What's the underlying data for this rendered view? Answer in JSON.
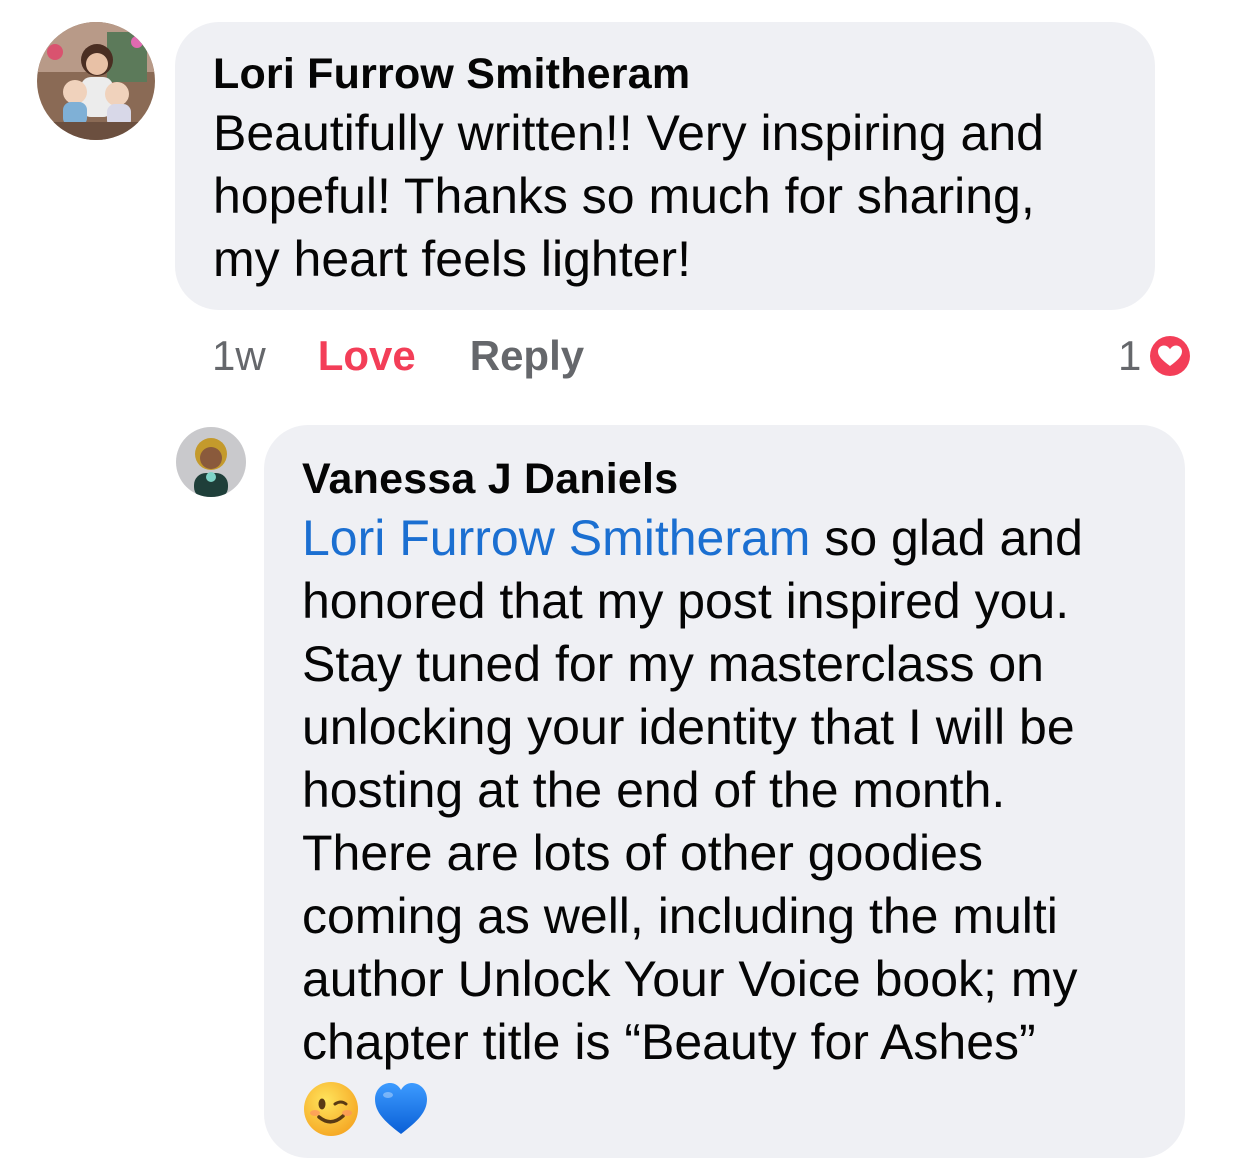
{
  "comment": {
    "author": "Lori Furrow Smitheram",
    "text_lines": [
      "Beautifully written!! Very inspiring and",
      "hopeful! Thanks so much for sharing,",
      "my heart feels lighter!"
    ],
    "time": "1w",
    "love_label": "Love",
    "reply_label": "Reply",
    "reaction_count": "1",
    "reaction_icon": "love-reaction-icon",
    "colors": {
      "love": "#f33e58",
      "bubble": "#eff0f4",
      "muted": "#65676b"
    }
  },
  "reply": {
    "author": "Vanessa J Daniels",
    "mention": "Lori Furrow Smitheram",
    "text_first_tail": " so glad and",
    "text_lines": [
      "honored that my post inspired you.",
      "Stay tuned for my masterclass on",
      "unlocking your identity that I will be",
      "hosting at the end of the month.",
      "There are lots of other goodies",
      "coming as well, including the multi",
      "author Unlock Your Voice book; my",
      "chapter title is “Beauty for Ashes”"
    ],
    "emojis": [
      "winking-face-emoji",
      "blue-heart-emoji"
    ],
    "colors": {
      "mention": "#1b6fd1"
    }
  }
}
